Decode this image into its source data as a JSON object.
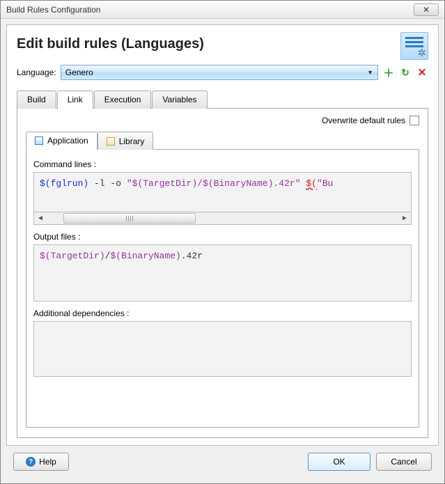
{
  "window": {
    "title": "Build Rules Configuration"
  },
  "heading": "Edit build rules (Languages)",
  "language": {
    "label": "Language:",
    "value": "Genero"
  },
  "outer_tabs": [
    "Build",
    "Link",
    "Execution",
    "Variables"
  ],
  "outer_active": "Link",
  "overwrite_label": "Overwrite default rules",
  "overwrite_checked": false,
  "inner_tabs": [
    "Application",
    "Library"
  ],
  "inner_active": "Application",
  "fields": {
    "command_lines": {
      "label": "Command lines :",
      "tokens": {
        "t1": "$(fglrun)",
        "t2": " -l -o ",
        "t3": "\"",
        "t4": "$(TargetDir)",
        "t5": "/",
        "t6": "$(BinaryName)",
        "t7": ".42r",
        "t8": "\" ",
        "t9": "$(",
        "t10": "\"Bu"
      }
    },
    "output_files": {
      "label": "Output files :",
      "tokens": {
        "t1": "$(TargetDir)",
        "t2": "/",
        "t3": "$(BinaryName)",
        "t4": ".42r"
      }
    },
    "additional_deps": {
      "label": "Additional dependencies :",
      "value": ""
    }
  },
  "buttons": {
    "help": "Help",
    "ok": "OK",
    "cancel": "Cancel"
  }
}
